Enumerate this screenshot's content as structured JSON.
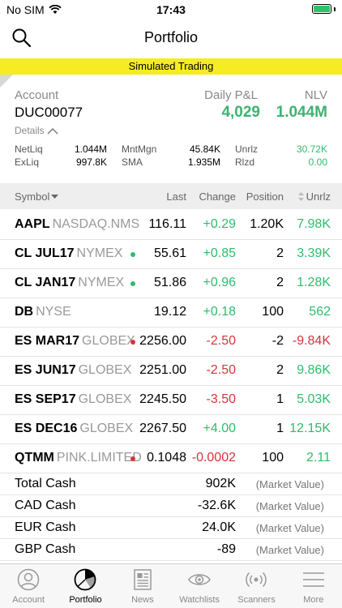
{
  "status": {
    "carrier": "No SIM",
    "time": "17:43"
  },
  "nav": {
    "title": "Portfolio"
  },
  "banner": "Simulated Trading",
  "account": {
    "label": "Account",
    "id": "DUC00077",
    "pnl_label": "Daily P&L",
    "pnl_value": "4,029",
    "nlv_label": "NLV",
    "nlv_value": "1.044M",
    "details_label": "Details",
    "metrics": [
      {
        "label": "NetLiq",
        "value": "1.044M"
      },
      {
        "label": "ExLiq",
        "value": "997.8K"
      },
      {
        "label": "MntMgn",
        "value": "45.84K"
      },
      {
        "label": "SMA",
        "value": "1.935M"
      },
      {
        "label": "Unrlz",
        "value": "30.72K"
      },
      {
        "label": "Rlzd",
        "value": "0.00"
      }
    ]
  },
  "table": {
    "headers": {
      "symbol": "Symbol",
      "last": "Last",
      "change": "Change",
      "position": "Position",
      "unrlz": "Unrlz"
    },
    "rows": [
      {
        "symbol": "AAPL",
        "exchange": "NASDAQ.NMS",
        "last": "116.11",
        "change": "+0.29",
        "position": "1.20K",
        "unrlz": "7.98K"
      },
      {
        "symbol": "CL JUL17",
        "exchange": "NYMEX",
        "last": "55.61",
        "change": "+0.85",
        "position": "2",
        "unrlz": "3.39K"
      },
      {
        "symbol": "CL JAN17",
        "exchange": "NYMEX",
        "last": "51.86",
        "change": "+0.96",
        "position": "2",
        "unrlz": "1.28K"
      },
      {
        "symbol": "DB",
        "exchange": "NYSE",
        "last": "19.12",
        "change": "+0.18",
        "position": "100",
        "unrlz": "562"
      },
      {
        "symbol": "ES MAR17",
        "exchange": "GLOBEX",
        "last": "2256.00",
        "change": "-2.50",
        "position": "-2",
        "unrlz": "-9.84K"
      },
      {
        "symbol": "ES JUN17",
        "exchange": "GLOBEX",
        "last": "2251.00",
        "change": "-2.50",
        "position": "2",
        "unrlz": "9.86K"
      },
      {
        "symbol": "ES SEP17",
        "exchange": "GLOBEX",
        "last": "2245.50",
        "change": "-3.50",
        "position": "1",
        "unrlz": "5.03K"
      },
      {
        "symbol": "ES DEC16",
        "exchange": "GLOBEX",
        "last": "2267.50",
        "change": "+4.00",
        "position": "1",
        "unrlz": "12.15K"
      },
      {
        "symbol": "QTMM",
        "exchange": "PINK.LIMITED",
        "last": "0.1048",
        "change": "-0.0002",
        "position": "100",
        "unrlz": "2.11"
      }
    ],
    "dots": {
      "cl_jul17": "green",
      "cl_jan17": "green",
      "es_mar17": "red",
      "qtmm": "red"
    }
  },
  "cash": [
    {
      "label": "Total Cash",
      "value": "902K",
      "note": "(Market Value)"
    },
    {
      "label": "CAD Cash",
      "value": "-32.6K",
      "note": "(Market Value)"
    },
    {
      "label": "EUR Cash",
      "value": "24.0K",
      "note": "(Market Value)"
    },
    {
      "label": "GBP Cash",
      "value": "-89",
      "note": "(Market Value)"
    }
  ],
  "tabs": [
    {
      "label": "Account",
      "icon": "account-icon"
    },
    {
      "label": "Portfolio",
      "icon": "portfolio-icon"
    },
    {
      "label": "News",
      "icon": "news-icon"
    },
    {
      "label": "Watchlists",
      "icon": "watchlist-eye-icon"
    },
    {
      "label": "Scanners",
      "icon": "scanner-icon"
    },
    {
      "label": "More",
      "icon": "more-menu-icon"
    }
  ],
  "colors": {
    "green": "#2ebd6b",
    "red": "#d9333a",
    "banner": "#f6ec22"
  }
}
